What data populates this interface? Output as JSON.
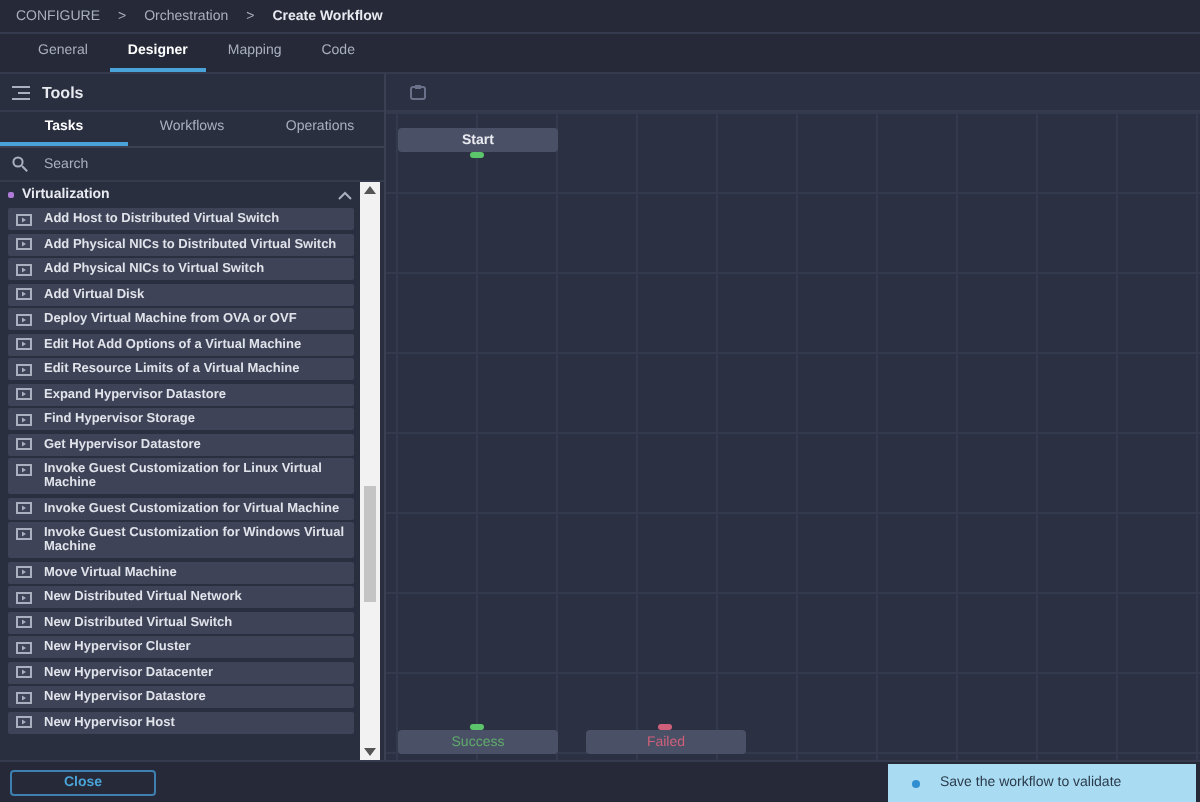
{
  "breadcrumb": [
    {
      "kind": "link",
      "label": "CONFIGURE"
    },
    {
      "kind": "separator",
      "label": ">"
    },
    {
      "kind": "link",
      "label": "Orchestration"
    },
    {
      "kind": "separator",
      "label": ">"
    },
    {
      "kind": "current",
      "label": "Create Workflow"
    }
  ],
  "tabs": [
    {
      "label": "General",
      "selected": false
    },
    {
      "label": "Designer",
      "selected": true
    },
    {
      "label": "Mapping",
      "selected": false
    },
    {
      "label": "Code",
      "selected": false
    }
  ],
  "tools_panel": {
    "title": "Tools",
    "tabs": [
      {
        "label": "Tasks",
        "selected": true
      },
      {
        "label": "Workflows",
        "selected": false
      },
      {
        "label": "Operations",
        "selected": false
      }
    ],
    "search": {
      "placeholder": "Search"
    },
    "group": {
      "label": "Virtualization",
      "expanded": true,
      "items": [
        "Add Host to Distributed Virtual Switch",
        "Add Physical NICs to Distributed Virtual Switch",
        "Add Physical NICs to Virtual Switch",
        "Add Virtual Disk",
        "Deploy Virtual Machine from OVA or OVF",
        "Edit Hot Add Options of a Virtual Machine",
        "Edit Resource Limits of a Virtual Machine",
        "Expand Hypervisor Datastore",
        "Find Hypervisor Storage",
        "Get Hypervisor Datastore",
        "Invoke Guest Customization for Linux Virtual Machine",
        "Invoke Guest Customization for Virtual Machine",
        "Invoke Guest Customization for Windows Virtual Machine",
        "Move Virtual Machine",
        "New Distributed Virtual Network",
        "New Distributed Virtual Switch",
        "New Hypervisor Cluster",
        "New Hypervisor Datacenter",
        "New Hypervisor Datastore",
        "New Hypervisor Host"
      ]
    }
  },
  "canvas": {
    "nodes": [
      {
        "kind": "start",
        "label": "Start"
      },
      {
        "kind": "success",
        "label": "Success"
      },
      {
        "kind": "failed",
        "label": "Failed"
      }
    ]
  },
  "footer": {
    "close_button": "Close",
    "toast": "Save the workflow to validate"
  }
}
